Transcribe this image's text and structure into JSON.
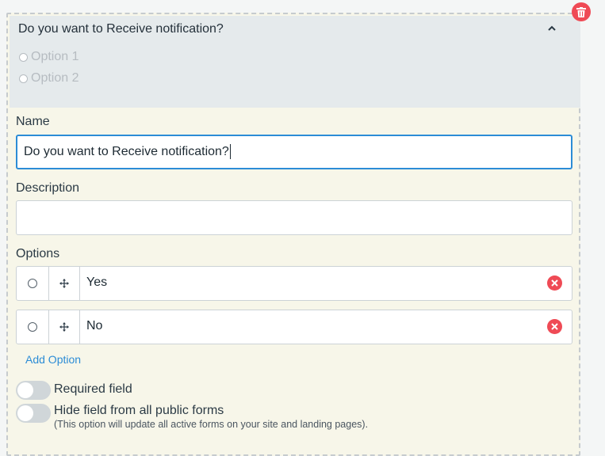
{
  "field_preview": {
    "title": "Do you want to Receive notification?",
    "options": [
      "Option 1",
      "Option 2"
    ]
  },
  "editor": {
    "name_label": "Name",
    "name_value": "Do you want to Receive notification?",
    "description_label": "Description",
    "description_value": "",
    "options_label": "Options",
    "options": [
      {
        "value": "Yes"
      },
      {
        "value": "No"
      }
    ],
    "add_option_label": "Add Option",
    "required_label": "Required field",
    "hide_label": "Hide field from all public forms",
    "hide_hint": "(This option will update all active forms on your site and landing pages)."
  },
  "icons": {
    "delete": "trash-icon",
    "collapse": "chevron-up-icon",
    "drag": "move-icon",
    "remove": "close-circle-icon"
  },
  "colors": {
    "accent": "#2c8cd6",
    "danger": "#ef4a55",
    "panel": "#f7f6e9",
    "preview": "#e5eaec"
  }
}
